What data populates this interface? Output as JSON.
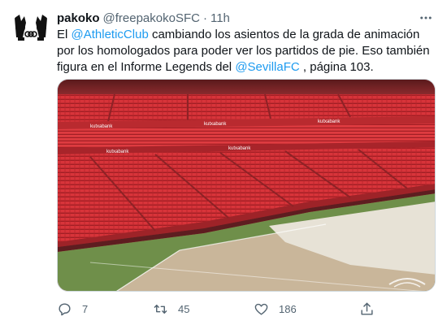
{
  "tweet": {
    "display_name": "pakoko",
    "handle": "@freepakokoSFC",
    "separator": "·",
    "time": "11h",
    "text_parts": {
      "t1": "El ",
      "m1": "@AthleticClub",
      "t2": " cambiando los asientos de la grada de animación por los homologados para poder ver los partidos de pie. Eso también figura en el Informe Legends del ",
      "m2": "@SevillaFC",
      "t3": " , página 103."
    },
    "media": {
      "sponsor_text": "kutxabank"
    },
    "actions": {
      "replies": "7",
      "retweets": "45",
      "likes": "186"
    }
  },
  "icons": {
    "more": "more-dots-icon",
    "reply": "reply-icon",
    "retweet": "retweet-icon",
    "like": "heart-icon",
    "share": "share-icon"
  },
  "colors": {
    "link": "#1d9bf0",
    "secondary_text": "#536471",
    "seats": "#d8343a"
  }
}
